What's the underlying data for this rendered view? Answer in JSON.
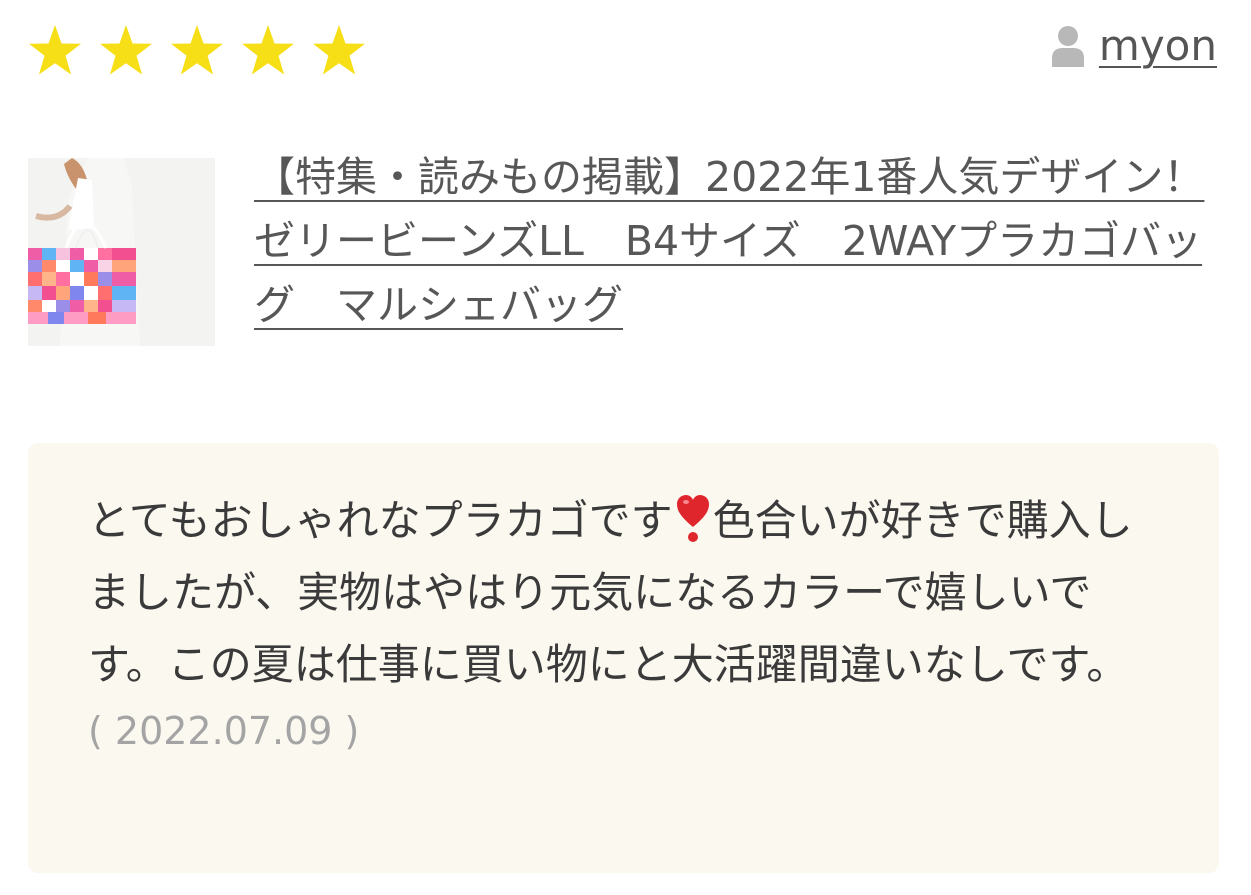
{
  "rating": {
    "value": 5,
    "max": 5,
    "color": "#f6df16"
  },
  "reviewer": {
    "icon": "user-icon",
    "name": "myon"
  },
  "product": {
    "thumbnail_icon": "product-thumbnail",
    "title": "【特集・読みもの掲載】2022年1番人気デザイン！ゼリービーンズLL　B4サイズ　2WAYプラカゴバッグ　マルシェバッグ"
  },
  "review": {
    "text_before_icon": "とてもおしゃれなプラカゴです",
    "inline_icon": "heart-exclamation-icon",
    "text_after_icon": "色合いが好きで購入しましたが、実物はやはり元気になるカラーで嬉しいです。この夏は仕事に買い物にと大活躍間違いなしです。",
    "date": "( 2022.07.09 )"
  },
  "colors": {
    "background": "#ffffff",
    "comment_box": "#fbf8f0",
    "date_text": "#a4a4a4",
    "heart": "#e0262d"
  }
}
